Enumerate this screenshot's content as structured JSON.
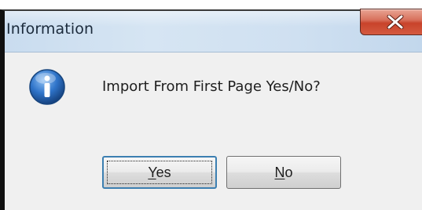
{
  "window": {
    "title": "Information",
    "close_icon": "close-icon"
  },
  "dialog": {
    "icon": "info-icon",
    "message": "Import From First Page Yes/No?"
  },
  "buttons": {
    "yes": {
      "mnemonic": "Y",
      "rest": "es"
    },
    "no": {
      "mnemonic": "N",
      "rest": "o"
    }
  },
  "colors": {
    "close_button": "#c8432b",
    "titlebar": "#cfe0f1",
    "focus_border": "#3c7fb1",
    "info_icon": "#1f5fb4"
  }
}
